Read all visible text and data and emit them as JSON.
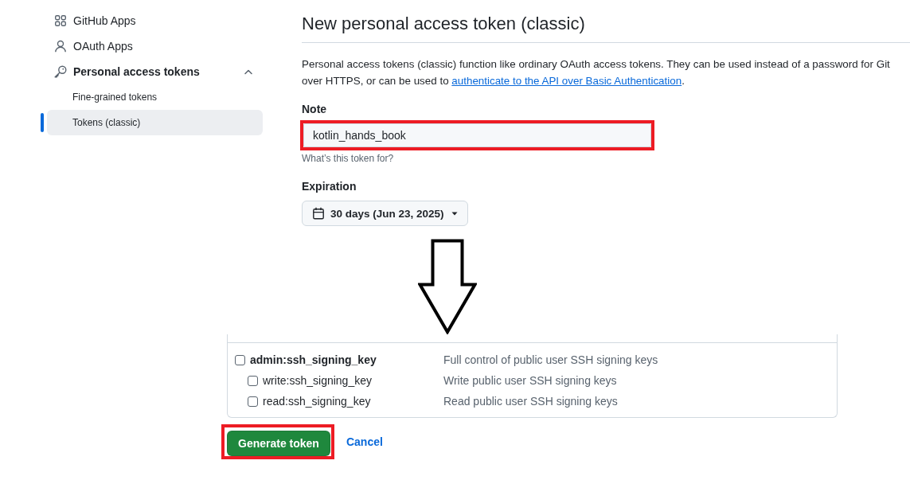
{
  "sidebar": {
    "items": [
      {
        "label": "GitHub Apps",
        "selected": false
      },
      {
        "label": "OAuth Apps",
        "selected": false
      },
      {
        "label": "Personal access tokens",
        "selected": false,
        "expanded": true,
        "children": [
          {
            "label": "Fine-grained tokens",
            "selected": false
          },
          {
            "label": "Tokens (classic)",
            "selected": true
          }
        ]
      }
    ]
  },
  "header": {
    "title": "New personal access token (classic)",
    "description": "Personal access tokens (classic) function like ordinary OAuth access tokens. They can be used instead of a password for Git over HTTPS, or can be used to",
    "link": "authenticate to the API over Basic Authentication",
    "description_end": "."
  },
  "note": {
    "label": "Note",
    "value": "kotlin_hands_book",
    "hint": "What’s this token for?",
    "highlighted": true
  },
  "expiration": {
    "label": "Expiration",
    "value": "30 days (Jun 23, 2025)"
  },
  "scopes": [
    {
      "name": "admin:ssh_signing_key",
      "description": "Full control of public user SSH signing keys",
      "checked": false,
      "children": [
        {
          "name": "write:ssh_signing_key",
          "description": "Write public user SSH signing keys",
          "checked": false
        },
        {
          "name": "read:ssh_signing_key",
          "description": "Read public user SSH signing keys",
          "checked": false
        }
      ]
    }
  ],
  "actions": {
    "generate": {
      "label": "Generate token",
      "highlighted": true
    },
    "cancel": {
      "label": "Cancel"
    }
  }
}
